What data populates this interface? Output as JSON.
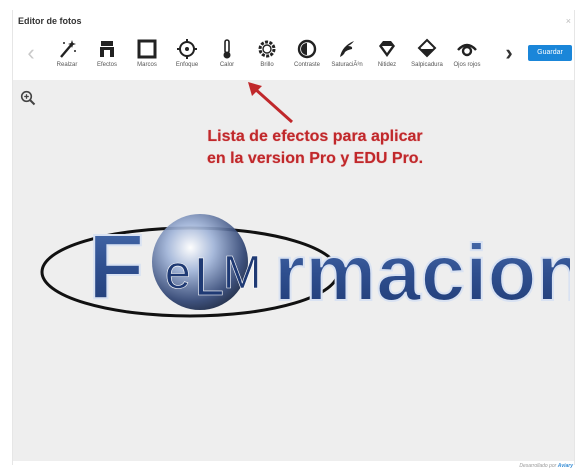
{
  "window": {
    "title": "Editor de fotos",
    "close": "×"
  },
  "toolbar": {
    "prev": "‹",
    "next": "›",
    "save_label": "Guardar",
    "tools": [
      {
        "label": "Realzar",
        "icon": "magic-wand-icon"
      },
      {
        "label": "Efectos",
        "icon": "effects-icon"
      },
      {
        "label": "Marcos",
        "icon": "frame-icon"
      },
      {
        "label": "Enfoque",
        "icon": "focus-icon"
      },
      {
        "label": "Calor",
        "icon": "thermometer-icon"
      },
      {
        "label": "Brillo",
        "icon": "brightness-icon"
      },
      {
        "label": "Contraste",
        "icon": "contrast-icon"
      },
      {
        "label": "SaturaciÃ³n",
        "icon": "saturation-icon"
      },
      {
        "label": "Nitidez",
        "icon": "sharpness-icon"
      },
      {
        "label": "Salpicadura",
        "icon": "splash-icon"
      },
      {
        "label": "Ojos rojos",
        "icon": "eye-icon"
      }
    ]
  },
  "annotation": {
    "line1": "Lista de efectos para aplicar",
    "line2": "en la version Pro y EDU Pro."
  },
  "logo": {
    "letter_f": "F",
    "letter_e": "e",
    "letter_l": "L",
    "letter_m": "M",
    "rest": "rmacion"
  },
  "footer": {
    "powered_text": "Desarrollado por",
    "powered_brand": "Aviary"
  },
  "colors": {
    "accent": "#1a86d9",
    "annotation": "#c0282b",
    "canvas": "#eeeeee"
  }
}
